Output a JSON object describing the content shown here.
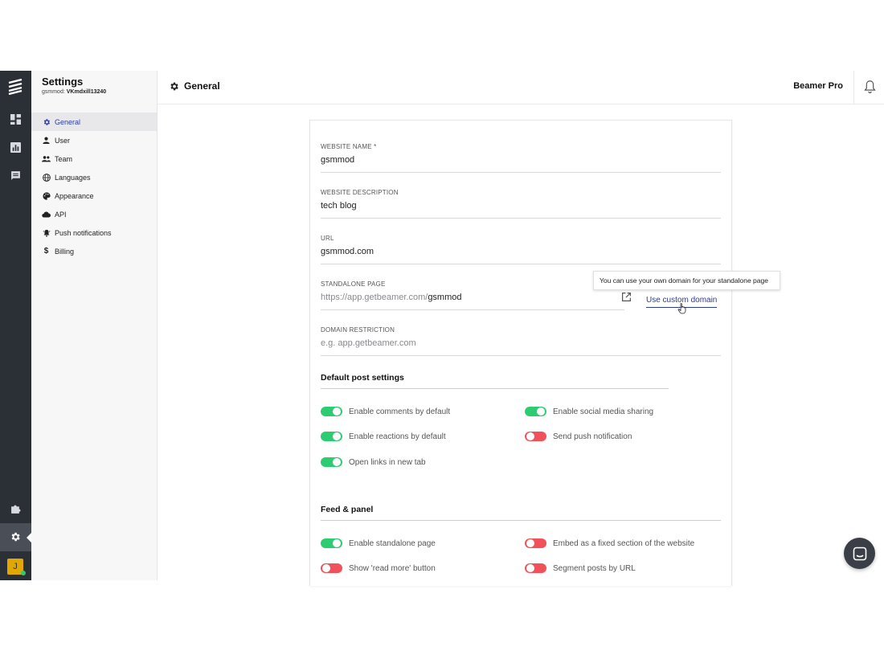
{
  "sidebar": {
    "title": "Settings",
    "account_label": "gsmmod:",
    "account_id": "VKmdxill13240",
    "items": [
      {
        "label": "General",
        "icon": "gear-icon",
        "active": true
      },
      {
        "label": "User",
        "icon": "user-icon"
      },
      {
        "label": "Team",
        "icon": "team-icon"
      },
      {
        "label": "Languages",
        "icon": "globe-icon"
      },
      {
        "label": "Appearance",
        "icon": "palette-icon"
      },
      {
        "label": "API",
        "icon": "cloud-icon"
      },
      {
        "label": "Push notifications",
        "icon": "bell-ring-icon"
      },
      {
        "label": "Billing",
        "icon": "dollar-icon"
      }
    ]
  },
  "rail": {
    "icons": [
      "logo-icon",
      "dashboard-icon",
      "analytics-icon",
      "chat-icon",
      "puzzle-icon",
      "settings-icon"
    ],
    "avatar_initial": "J"
  },
  "header": {
    "title": "General",
    "plan": "Beamer Pro"
  },
  "form": {
    "website_name": {
      "label": "WEBSITE NAME *",
      "value": "gsmmod"
    },
    "website_description": {
      "label": "WEBSITE DESCRIPTION",
      "value": "tech blog"
    },
    "url": {
      "label": "URL",
      "value": "gsmmod.com"
    },
    "standalone_page": {
      "label": "STANDALONE PAGE",
      "prefix": "https://app.getbeamer.com/",
      "value": "gsmmod",
      "link": "Use custom domain",
      "tooltip": "You can use your own domain for your standalone page"
    },
    "domain_restriction": {
      "label": "DOMAIN RESTRICTION",
      "placeholder": "e.g. app.getbeamer.com"
    }
  },
  "default_post_settings": {
    "title": "Default post settings",
    "toggles": [
      {
        "label": "Enable comments by default",
        "on": true
      },
      {
        "label": "Enable social media sharing",
        "on": true
      },
      {
        "label": "Enable reactions by default",
        "on": true
      },
      {
        "label": "Send push notification",
        "on": false
      },
      {
        "label": "Open links in new tab",
        "on": true
      }
    ]
  },
  "feed_panel": {
    "title": "Feed & panel",
    "toggles": [
      {
        "label": "Enable standalone page",
        "on": true
      },
      {
        "label": "Embed as a fixed section of the website",
        "on": false
      },
      {
        "label": "Show 'read more' button",
        "on": false
      },
      {
        "label": "Segment posts by URL",
        "on": false
      }
    ]
  },
  "colors": {
    "accent": "#2b3b9e",
    "toggle_on": "#2ecc71",
    "toggle_off": "#f0515a",
    "rail": "#2b2f36"
  }
}
